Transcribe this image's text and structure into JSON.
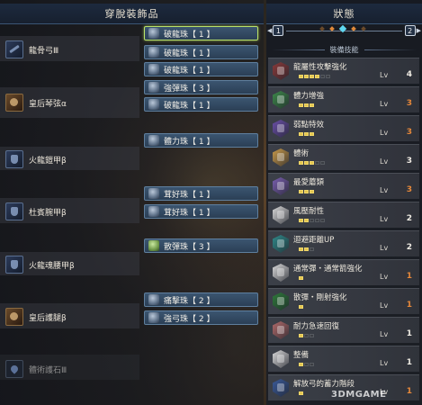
{
  "left_panel": {
    "title": "穿脫裝飾品",
    "slots": [
      {
        "name": "龍骨弓Ⅲ",
        "icon": "bow-icon"
      },
      {
        "name": "皇后琴弦α",
        "icon": "charm-armor-icon"
      },
      {
        "name": "火龍鎧甲β",
        "icon": "chest-armor-icon"
      },
      {
        "name": "杜賓腕甲β",
        "icon": "arm-armor-icon"
      },
      {
        "name": "火龍魂腰甲β",
        "icon": "waist-armor-icon"
      },
      {
        "name": "皇后護腿β",
        "icon": "leg-armor-icon"
      },
      {
        "name": "體術護石Ⅲ",
        "icon": "charm-icon"
      }
    ],
    "decorations": [
      {
        "label": "破龍珠【 1 】",
        "icon": "jewel-icon",
        "selected": true
      },
      {
        "label": "破龍珠【 1 】",
        "icon": "jewel-icon",
        "selected": false
      },
      {
        "label": "破龍珠【 1 】",
        "icon": "jewel-icon",
        "selected": false
      },
      {
        "label": "強彈珠【 3 】",
        "icon": "jewel-icon",
        "selected": false
      },
      {
        "label": "破龍珠【 1 】",
        "icon": "jewel-icon",
        "selected": false
      },
      {
        "label": "體力珠【 1 】",
        "icon": "jewel-icon",
        "selected": false
      },
      {
        "label": "茸好珠【 1 】",
        "icon": "jewel-icon",
        "selected": false
      },
      {
        "label": "茸好珠【 1 】",
        "icon": "jewel-icon",
        "selected": false
      },
      {
        "label": "散彈珠【 3 】",
        "icon": "jewel-green-icon",
        "selected": false
      },
      {
        "label": "痛擊珠【 2 】",
        "icon": "jewel-icon",
        "selected": false
      },
      {
        "label": "強弓珠【 2 】",
        "icon": "jewel-icon",
        "selected": false
      }
    ]
  },
  "right_panel": {
    "title": "狀態",
    "pager": {
      "left_key": "1",
      "right_key": "2"
    },
    "skills_title": "裝備技能",
    "skills": [
      {
        "name": "龍屬性攻擊強化",
        "level": 4,
        "max": 6,
        "color": "#8a3a3a"
      },
      {
        "name": "體力增強",
        "level": 3,
        "max": 3,
        "color": "#3d8a4a"
      },
      {
        "name": "弱點特效",
        "level": 3,
        "max": 3,
        "color": "#6a4fa8"
      },
      {
        "name": "體術",
        "level": 3,
        "max": 5,
        "color": "#c89a4a"
      },
      {
        "name": "最愛蘑類",
        "level": 3,
        "max": 3,
        "color": "#7a5fb0"
      },
      {
        "name": "風壓耐性",
        "level": 2,
        "max": 5,
        "color": "#d8d8d8"
      },
      {
        "name": "迴避距離UP",
        "level": 2,
        "max": 3,
        "color": "#2f8a8a"
      },
      {
        "name": "通常彈・通常箭強化",
        "level": 1,
        "max": 1,
        "color": "#d8d8d8"
      },
      {
        "name": "散彈・剛射強化",
        "level": 1,
        "max": 1,
        "color": "#2e7a3a"
      },
      {
        "name": "耐力急速回復",
        "level": 1,
        "max": 3,
        "color": "#b06a6a"
      },
      {
        "name": "整備",
        "level": 1,
        "max": 3,
        "color": "#d8d8d8"
      },
      {
        "name": "解放弓的蓄力階段",
        "level": 1,
        "max": 1,
        "color": "#3a5a9a"
      }
    ],
    "lv_label": "Lv",
    "level_color_max": "#e6883a",
    "level_color_normal": "#f0ece4"
  },
  "watermark": "3DMGAME"
}
